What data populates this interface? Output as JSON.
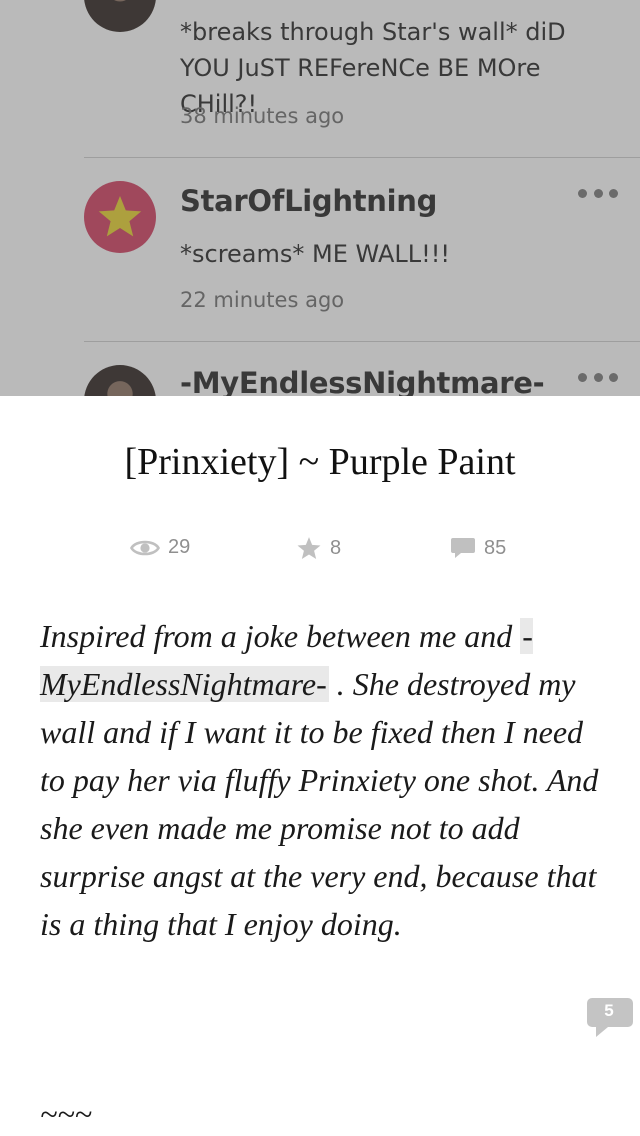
{
  "comments": [
    {
      "username": "",
      "avatar": "user-photo-avatar",
      "text": "*breaks through Star's wall* diD YOU JuST REFereNCe BE MOre CHill?!",
      "time": "38 minutes ago"
    },
    {
      "username": "StarOfLightning",
      "avatar": "star-avatar",
      "text": "*screams* ME WALL!!!",
      "time": "22 minutes ago"
    },
    {
      "username": "-MyEndlessNightmare-",
      "avatar": "user-photo-avatar",
      "text": "",
      "time": ""
    }
  ],
  "story": {
    "title": "[Prinxiety] ~ Purple Paint",
    "stats": {
      "reads": "29",
      "votes": "8",
      "comments": "85"
    },
    "body_before": "Inspired from a joke between me and ",
    "mention": "-MyEndlessNightmare-",
    "body_after": " . She destroyed my wall and if I want it to be fixed then I need to pay her via fluffy Prinxiety one shot. And she even made me promise not to add surprise angst at the very end, because that is a thing that I enjoy doing.",
    "separator": "~~~",
    "inline_comment_count": "5"
  },
  "colors": {
    "star_avatar_bg": "#d23c5e",
    "star_fill": "#e8d22a",
    "stat_gray": "#8f8f8f",
    "badge_gray": "#c4c4c4"
  }
}
